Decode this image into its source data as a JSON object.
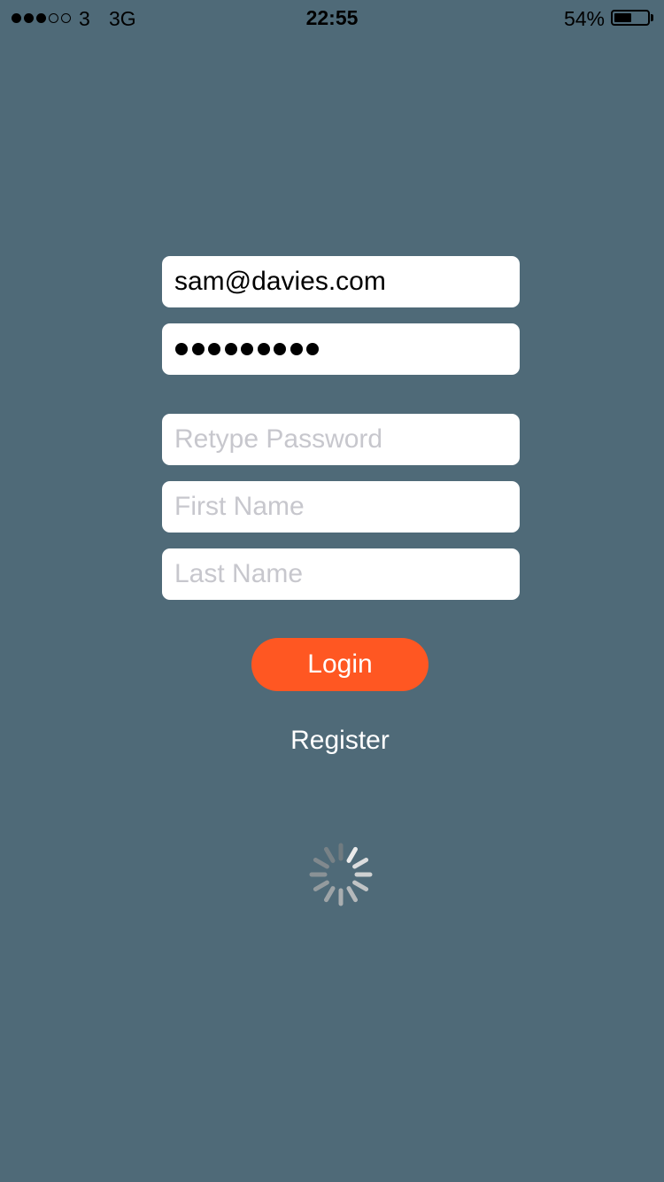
{
  "status_bar": {
    "signal_bars_filled": 3,
    "signal_bars_total": 5,
    "carrier": "3",
    "network": "3G",
    "time": "22:55",
    "battery_percent_label": "54%",
    "battery_level": 0.54
  },
  "form": {
    "email_value": "sam@davies.com",
    "password_masked_length": 9,
    "retype_password_placeholder": "Retype Password",
    "first_name_placeholder": "First Name",
    "last_name_placeholder": "Last Name"
  },
  "actions": {
    "login_label": "Login",
    "register_label": "Register"
  },
  "colors": {
    "background": "#4f6a78",
    "login_button": "#ff5722",
    "placeholder_text": "#c7c7cd"
  },
  "icons": {
    "loading": "activity-spinner-icon"
  }
}
